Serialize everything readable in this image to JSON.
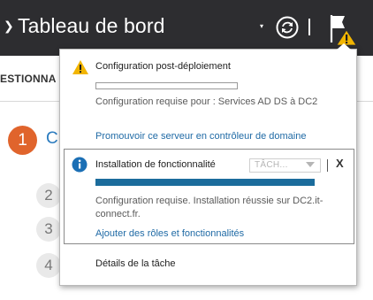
{
  "header": {
    "title": "Tableau de bord",
    "back_glyph": "❯",
    "caret_glyph": "▾",
    "icons": {
      "refresh": "refresh-icon",
      "notifications": "notification-flag-warning-icon"
    }
  },
  "background": {
    "sub_bar_text": "ESTIONNA",
    "step_1_number": "1",
    "step_1_letter": "C",
    "steps": [
      "2",
      "3",
      "4"
    ]
  },
  "notifications": [
    {
      "type": "warning",
      "icon": "warning-icon",
      "title": "Configuration post-déploiement",
      "progress": 0,
      "description": "Configuration requise pour : Services AD DS à DC2",
      "link": "Promouvoir ce serveur en contrôleur de domaine"
    },
    {
      "type": "info",
      "icon": "info-icon",
      "title": "Installation de fonctionnalité",
      "tasks_label": "TÂCH...",
      "close_label": "X",
      "progress": 1,
      "description": "Configuration requise. Installation réussie sur DC2.it-connect.fr.",
      "link": "Ajouter des rôles et fonctionnalités"
    }
  ],
  "footer": {
    "task_details": "Détails de la tâche"
  },
  "colors": {
    "header_bg": "#2d2d30",
    "accent_orange": "#e0642c",
    "link_blue": "#1f6aa5",
    "progress_blue": "#1b6c9c",
    "warning_yellow": "#f2b500",
    "info_blue": "#1b6fb5"
  }
}
